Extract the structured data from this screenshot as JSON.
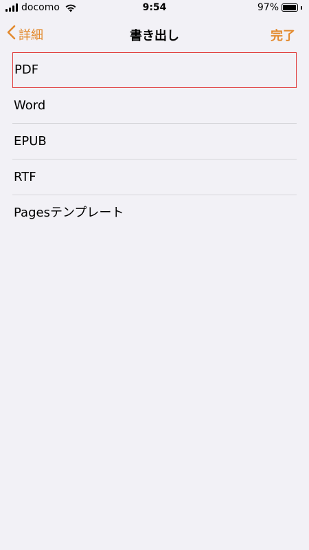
{
  "status_bar": {
    "carrier": "docomo",
    "time": "9:54",
    "battery": "97%",
    "battery_level": 0.97,
    "signal_bars": 4
  },
  "nav": {
    "back_label": "詳細",
    "title": "書き出し",
    "done_label": "完了"
  },
  "export_options": [
    {
      "label": "PDF",
      "highlighted": true
    },
    {
      "label": "Word",
      "highlighted": false
    },
    {
      "label": "EPUB",
      "highlighted": false
    },
    {
      "label": "RTF",
      "highlighted": false
    },
    {
      "label": "Pagesテンプレート",
      "highlighted": false
    }
  ],
  "colors": {
    "accent": "#e38a2e",
    "background": "#f2f1f6",
    "highlight_border": "#e03a3a",
    "separator": "#d6d6da"
  },
  "icons": {
    "back": "chevron-left-icon",
    "wifi": "wifi-icon",
    "signal": "signal-icon",
    "battery": "battery-icon"
  }
}
